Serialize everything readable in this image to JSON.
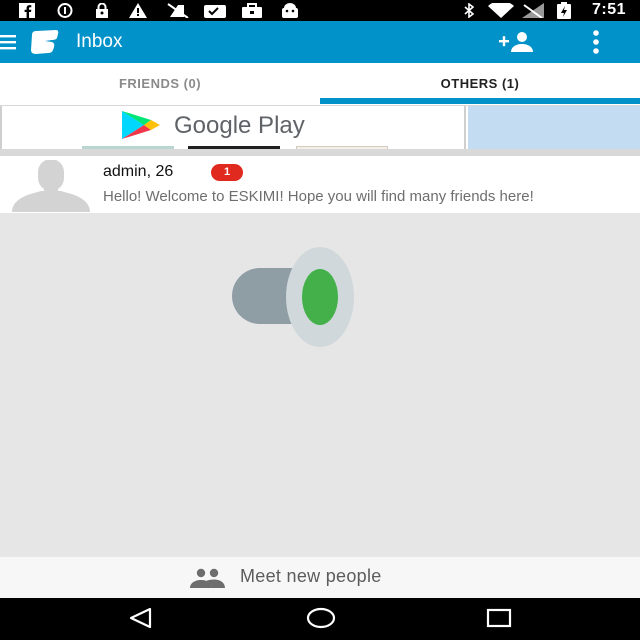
{
  "status_bar": {
    "time": "7:51",
    "icons": [
      "facebook-icon",
      "circle-icon",
      "lock-icon",
      "warning-icon",
      "no-sim-icon",
      "checklist-icon",
      "briefcase-icon",
      "android-icon",
      "bluetooth-icon",
      "wifi-icon",
      "signal-icon",
      "battery-charging-icon"
    ]
  },
  "app_bar": {
    "title": "Inbox",
    "accent_color": "#0092c9"
  },
  "tabs": [
    {
      "label": "FRIENDS (0)",
      "selected": false
    },
    {
      "label": "OTHERS (1)",
      "selected": true
    }
  ],
  "ad": {
    "brand": "Google Play"
  },
  "messages": [
    {
      "sender": "admin, 26",
      "unread_count": "1",
      "preview": "Hello! Welcome to ESKIMI! Hope you will find many friends here!"
    }
  ],
  "bottom_action": {
    "label": "Meet new people"
  },
  "colors": {
    "badge": "#e02a1f",
    "background": "#e6e6e6"
  }
}
